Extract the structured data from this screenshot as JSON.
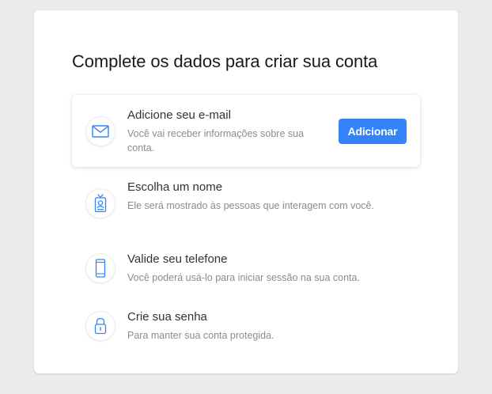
{
  "page": {
    "title": "Complete os dados para criar sua conta"
  },
  "steps": [
    {
      "icon": "envelope-icon",
      "title": "Adicione seu e-mail",
      "description": "Você vai receber informações sobre sua conta.",
      "button_label": "Adicionar"
    },
    {
      "icon": "id-badge-icon",
      "title": "Escolha um nome",
      "description": "Ele será mostrado às pessoas que interagem com você."
    },
    {
      "icon": "smartphone-icon",
      "title": "Valide seu telefone",
      "description": "Você poderá usá-lo para iniciar sessão na sua conta."
    },
    {
      "icon": "padlock-icon",
      "title": "Crie sua senha",
      "description": "Para manter sua conta protegida."
    }
  ],
  "colors": {
    "accent": "#3483fa",
    "background": "#ebebeb",
    "card": "#ffffff",
    "text_primary": "#333333",
    "text_secondary": "#8c8c8c"
  }
}
